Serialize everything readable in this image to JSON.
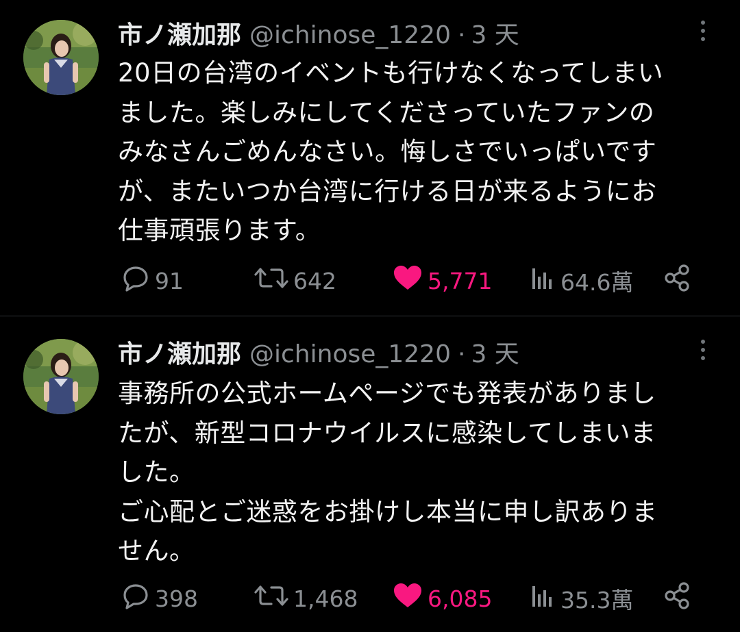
{
  "colors": {
    "background": "#000000",
    "text": "#e7e9ea",
    "secondary": "#8b8f93",
    "like": "#f91880",
    "divider": "#2f3336"
  },
  "tweets": [
    {
      "display_name": "市ノ瀬加那",
      "handle": "@ichinose_1220",
      "separator": "·",
      "time": "3 天",
      "body_lines": [
        "20日の台湾のイベントも行けなくなってしまい",
        "ました。楽しみにしてくださっていたファンの",
        "みなさんごめんなさい。悔しさでいっぱいです",
        "が、またいつか台湾に行ける日が来るようにお",
        "仕事頑張ります。"
      ],
      "stats": {
        "replies": "91",
        "retweets": "642",
        "likes": "5,771",
        "views": "64.6萬"
      },
      "liked": true
    },
    {
      "display_name": "市ノ瀬加那",
      "handle": "@ichinose_1220",
      "separator": "·",
      "time": "3 天",
      "body_lines": [
        "事務所の公式ホームページでも発表がありまし",
        "たが、新型コロナウイルスに感染してしまいま",
        "した。",
        "ご心配とご迷惑をお掛けし本当に申し訳ありま",
        "せん。"
      ],
      "stats": {
        "replies": "398",
        "retweets": "1,468",
        "likes": "6,085",
        "views": "35.3萬"
      },
      "liked": true
    }
  ],
  "icons": {
    "more": "more-vertical-icon",
    "reply": "reply-icon",
    "retweet": "retweet-icon",
    "like": "heart-filled-icon",
    "views": "views-chart-icon",
    "share": "share-icon"
  }
}
